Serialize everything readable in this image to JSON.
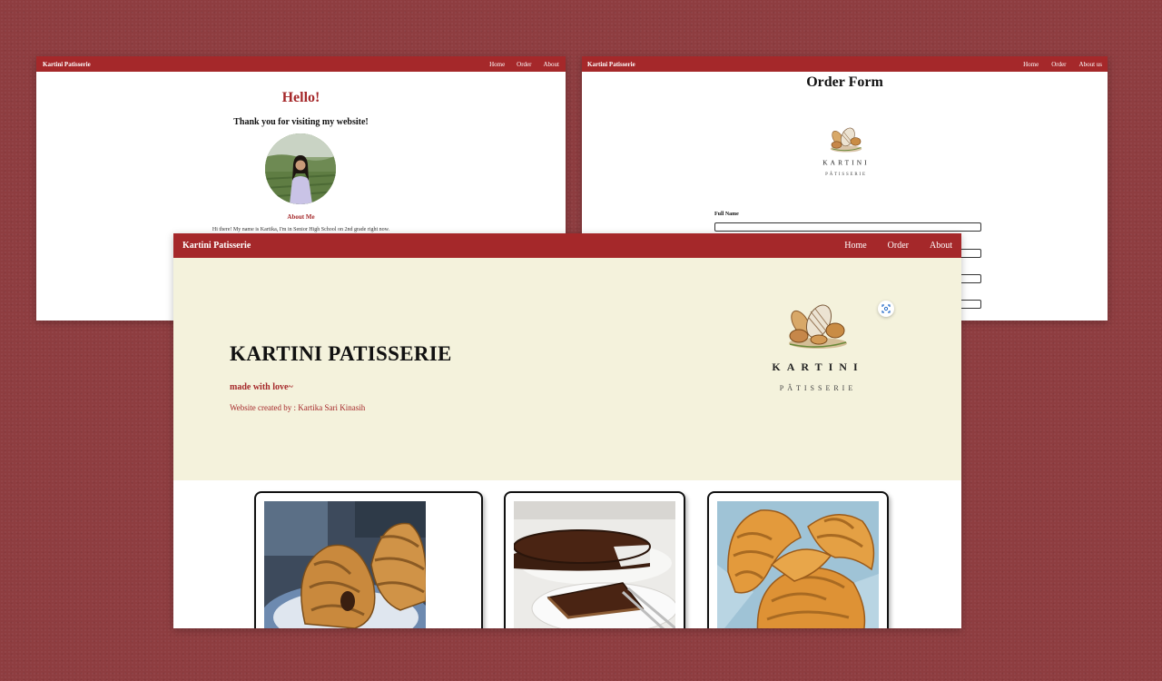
{
  "shot1": {
    "nav": {
      "brand": "Kartini Patisserie",
      "links": [
        "Home",
        "Order",
        "About"
      ]
    },
    "hello": "Hello!",
    "thanks": "Thank you for visiting my website!",
    "about_heading": "About Me",
    "intro": "Hi there! My name is Kartika, I'm in Senior High School on 2nd grade right now."
  },
  "shot2": {
    "nav": {
      "brand": "Kartini Patisserie",
      "links": [
        "Home",
        "Order",
        "About us"
      ]
    },
    "title": "Order Form",
    "logo": {
      "name": "KARTINI",
      "sub": "PÂTISSERIE"
    },
    "full_name_label": "Full Name"
  },
  "main": {
    "nav": {
      "brand": "Kartini Patisserie",
      "links": [
        "Home",
        "Order",
        "About"
      ]
    },
    "hero": {
      "title": "KARTINI PATISSERIE",
      "tagline": "made with love~",
      "credit": "Website created by : Kartika Sari Kinasih",
      "logo": {
        "name": "KARTINI",
        "sub": "PÂTISSERIE"
      }
    },
    "products": [
      {
        "image": "pain-au-chocolat"
      },
      {
        "image": "chocolate-tart"
      },
      {
        "image": "croissants"
      }
    ]
  },
  "colors": {
    "brand_red": "#a5282a",
    "hero_bg": "#f4f2dc",
    "backdrop": "#8e3d40"
  }
}
